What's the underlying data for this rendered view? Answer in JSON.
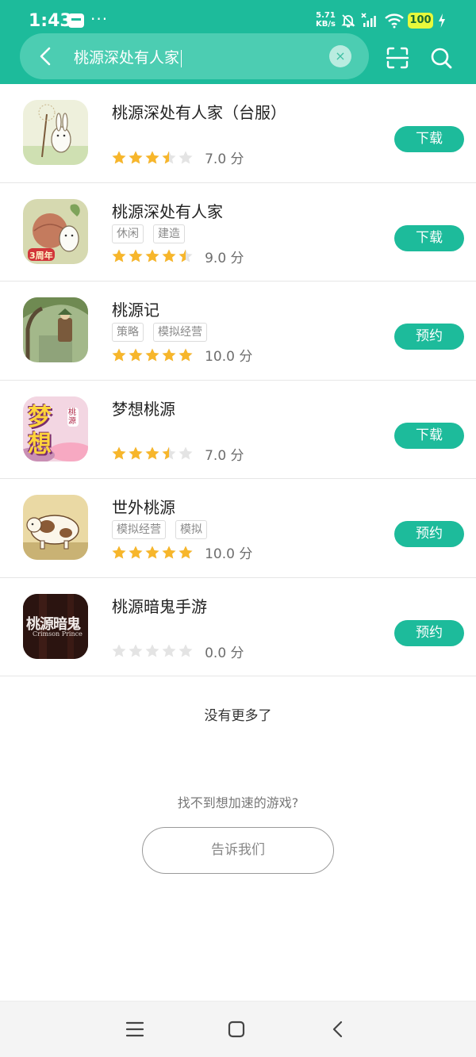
{
  "status_bar": {
    "time": "1:43",
    "more": "···",
    "net_speed_value": "5.71",
    "net_speed_unit": "KB/s",
    "battery": "100"
  },
  "search": {
    "query": "桃源深处有人家",
    "clear_glyph": "×"
  },
  "games": [
    {
      "name": "桃源深处有人家（台服）",
      "tags": [],
      "stars": 3.5,
      "score": "7.0 分",
      "action": "下载",
      "icon": "dandelion-rabbit-icon"
    },
    {
      "name": "桃源深处有人家",
      "tags": [
        "休闲",
        "建造"
      ],
      "stars": 4.5,
      "score": "9.0 分",
      "action": "下载",
      "icon": "peach-rabbit-icon",
      "badge": "3周年"
    },
    {
      "name": "桃源记",
      "tags": [
        "策略",
        "模拟经营"
      ],
      "stars": 5,
      "score": "10.0 分",
      "action": "预约",
      "icon": "ink-painting-icon"
    },
    {
      "name": "梦想桃源",
      "tags": [],
      "stars": 3.5,
      "score": "7.0 分",
      "action": "下载",
      "icon": "dream-logo-icon",
      "logo_text": "梦想",
      "logo_sub": "桃源"
    },
    {
      "name": "世外桃源",
      "tags": [
        "模拟经营",
        "模拟"
      ],
      "stars": 5,
      "score": "10.0 分",
      "action": "预约",
      "icon": "cow-icon"
    },
    {
      "name": "桃源暗鬼手游",
      "tags": [],
      "stars": 0,
      "score": "0.0 分",
      "action": "预约",
      "icon": "dark-ghost-icon",
      "logo_text": "桃源暗鬼",
      "logo_sub": "Crimson Prince"
    }
  ],
  "footer": {
    "no_more": "没有更多了",
    "not_found": "找不到想加速的游戏?",
    "tell_us": "告诉我们"
  },
  "colors": {
    "accent": "#1dbb9b",
    "star_on": "#f7b62b",
    "star_off": "#e4e4e4"
  }
}
